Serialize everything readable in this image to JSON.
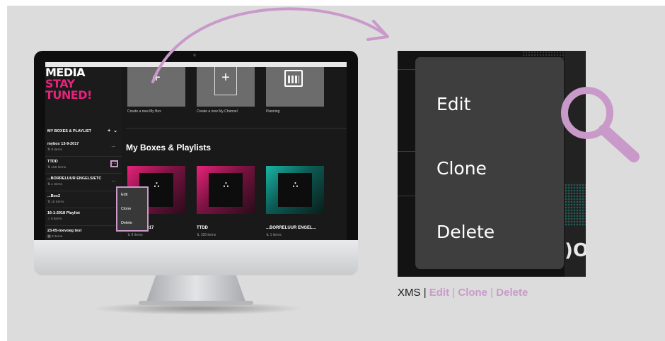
{
  "brand": {
    "line1": "MEDIA",
    "line2": "STAY",
    "line3": "TUNED!",
    "accent_color": "#e6237a"
  },
  "highlight_color": "#c99ac9",
  "sidebar": {
    "heading": "MY BOXES & PLAYLIST",
    "add_icon": "plus-icon",
    "collapse_icon": "chevron-down-icon",
    "items": [
      {
        "title": "mybox 13-9-2017",
        "meta": "8 items",
        "icon": "shuffle-icon"
      },
      {
        "title": "TTDD",
        "meta": "189 items",
        "icon": "shuffle-icon"
      },
      {
        "title": "...BORRELUUR ENGELS/ETC",
        "meta": "1 items",
        "icon": "shuffle-icon"
      },
      {
        "title": "...Box2",
        "meta": "18 items",
        "icon": "shuffle-icon"
      },
      {
        "title": "16-1-2018 Playlist",
        "meta": "6 items",
        "icon": "music-icon"
      },
      {
        "title": "23-05-toevoeg test",
        "meta": "0 items",
        "icon": "calendar-icon"
      }
    ],
    "more_glyph": "…"
  },
  "context_menu": {
    "items": [
      "Edit",
      "Clone",
      "Delete"
    ]
  },
  "main": {
    "tiles": [
      {
        "label": "Create a new My Box",
        "glyph": "+"
      },
      {
        "label": "Create a new My Channel",
        "glyph": "+"
      },
      {
        "label": "Planning",
        "glyph": ""
      }
    ],
    "section_title": "My Boxes & Playlists",
    "boxes": [
      {
        "title": "...x 13-9-2017",
        "meta": "8 items",
        "theme": "pink"
      },
      {
        "title": "TTDD",
        "meta": "189 items",
        "theme": "pink"
      },
      {
        "title": "...BORRELUUR ENGEL...",
        "meta": "1 items",
        "theme": "teal"
      }
    ],
    "box_logo": "∴"
  },
  "zoom": {
    "items": [
      "Edit",
      "Clone",
      "Delete"
    ],
    "fragment": ")OX"
  },
  "caption": {
    "prefix": "XMS",
    "sep": "|",
    "links": [
      "Edit",
      "Clone",
      "Delete"
    ]
  }
}
